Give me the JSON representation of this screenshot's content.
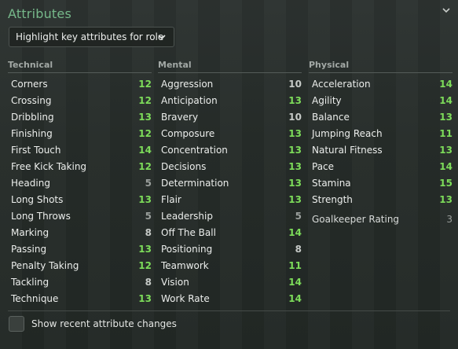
{
  "panel": {
    "title": "Attributes",
    "dropdown_label": "Highlight key attributes for role",
    "checkbox_label": "Show recent attribute changes"
  },
  "colors": {
    "high": "#7ddc5a",
    "mid": "#c6cac7",
    "low": "#9a9f9c",
    "title": "#76b88a"
  },
  "icons": {
    "collapse": "chevron-down-icon",
    "dropdown": "chevron-down-icon"
  },
  "technical": {
    "header": "Technical",
    "items": [
      {
        "label": "Corners",
        "value": "12"
      },
      {
        "label": "Crossing",
        "value": "12"
      },
      {
        "label": "Dribbling",
        "value": "13"
      },
      {
        "label": "Finishing",
        "value": "12"
      },
      {
        "label": "First Touch",
        "value": "14"
      },
      {
        "label": "Free Kick Taking",
        "value": "12"
      },
      {
        "label": "Heading",
        "value": "5"
      },
      {
        "label": "Long Shots",
        "value": "13"
      },
      {
        "label": "Long Throws",
        "value": "5"
      },
      {
        "label": "Marking",
        "value": "8"
      },
      {
        "label": "Passing",
        "value": "13"
      },
      {
        "label": "Penalty Taking",
        "value": "12"
      },
      {
        "label": "Tackling",
        "value": "8"
      },
      {
        "label": "Technique",
        "value": "13"
      }
    ]
  },
  "mental": {
    "header": "Mental",
    "items": [
      {
        "label": "Aggression",
        "value": "10"
      },
      {
        "label": "Anticipation",
        "value": "13"
      },
      {
        "label": "Bravery",
        "value": "10"
      },
      {
        "label": "Composure",
        "value": "13"
      },
      {
        "label": "Concentration",
        "value": "13"
      },
      {
        "label": "Decisions",
        "value": "13"
      },
      {
        "label": "Determination",
        "value": "13"
      },
      {
        "label": "Flair",
        "value": "13"
      },
      {
        "label": "Leadership",
        "value": "5"
      },
      {
        "label": "Off The Ball",
        "value": "14"
      },
      {
        "label": "Positioning",
        "value": "8"
      },
      {
        "label": "Teamwork",
        "value": "11"
      },
      {
        "label": "Vision",
        "value": "14"
      },
      {
        "label": "Work Rate",
        "value": "14"
      }
    ]
  },
  "physical": {
    "header": "Physical",
    "items": [
      {
        "label": "Acceleration",
        "value": "14"
      },
      {
        "label": "Agility",
        "value": "14"
      },
      {
        "label": "Balance",
        "value": "13"
      },
      {
        "label": "Jumping Reach",
        "value": "11"
      },
      {
        "label": "Natural Fitness",
        "value": "13"
      },
      {
        "label": "Pace",
        "value": "14"
      },
      {
        "label": "Stamina",
        "value": "15"
      },
      {
        "label": "Strength",
        "value": "13"
      }
    ],
    "goalkeeper_rating": {
      "label": "Goalkeeper Rating",
      "value": "3"
    }
  }
}
